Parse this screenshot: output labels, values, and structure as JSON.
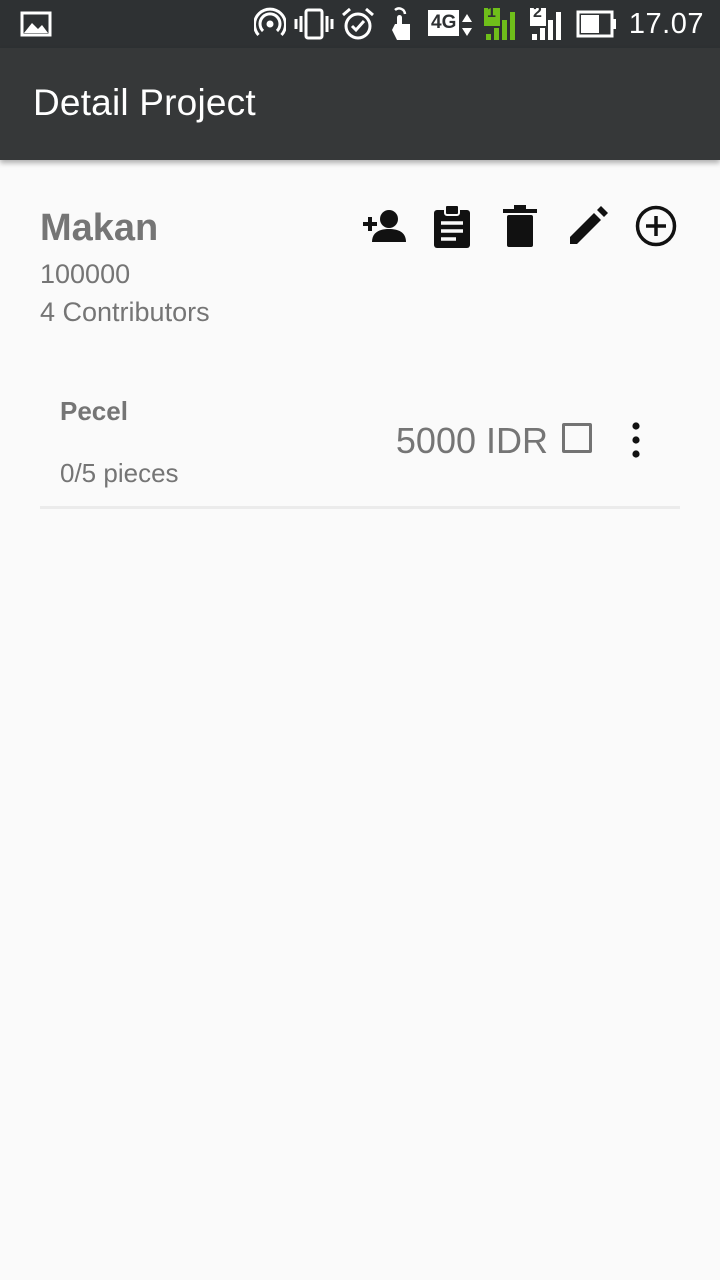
{
  "status_bar": {
    "time": "17.07",
    "network_type": "4G",
    "sim1_label": "1",
    "sim2_label": "2",
    "icons": [
      "gallery-notification-icon",
      "hotspot-icon",
      "vibrate-icon",
      "alarm-icon",
      "touch-icon",
      "network-4g-icon",
      "signal-sim1-icon",
      "signal-sim2-icon",
      "battery-icon"
    ],
    "sim1_color": "#6fbf1a"
  },
  "app_bar": {
    "title": "Detail Project",
    "background": "#363839"
  },
  "project": {
    "name": "Makan",
    "budget": "100000",
    "contributors": "4 Contributors",
    "actions": [
      {
        "name": "add-contributor",
        "icon": "person-add-icon"
      },
      {
        "name": "report",
        "icon": "clipboard-icon"
      },
      {
        "name": "delete",
        "icon": "trash-icon"
      },
      {
        "name": "edit",
        "icon": "pencil-icon"
      },
      {
        "name": "add-item",
        "icon": "plus-circle-icon"
      }
    ]
  },
  "items": [
    {
      "name": "Pecel",
      "quantity": "0/5 pieces",
      "price": "5000 IDR",
      "checked": false
    }
  ]
}
